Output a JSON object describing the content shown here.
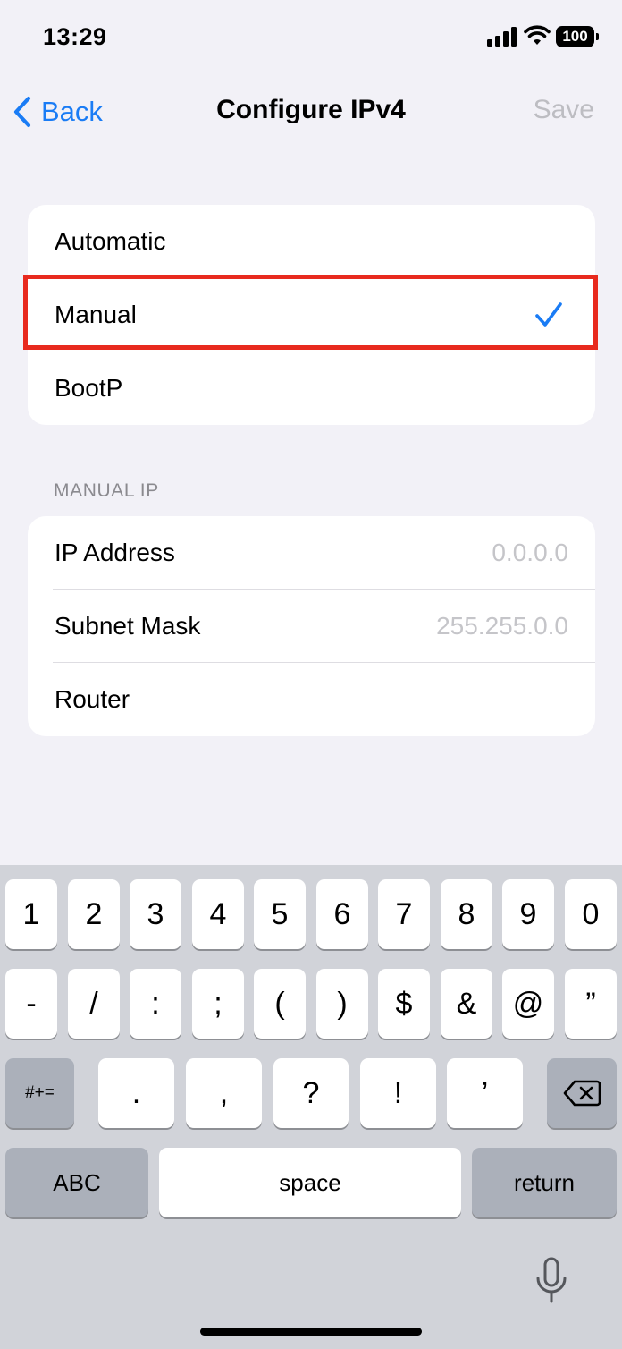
{
  "status_bar": {
    "time": "13:29",
    "battery": "100"
  },
  "nav": {
    "back_label": "Back",
    "title": "Configure IPv4",
    "save_label": "Save"
  },
  "modes": [
    {
      "label": "Automatic",
      "selected": false
    },
    {
      "label": "Manual",
      "selected": true
    },
    {
      "label": "BootP",
      "selected": false
    }
  ],
  "manual_ip": {
    "header": "MANUAL IP",
    "fields": [
      {
        "label": "IP Address",
        "placeholder": "0.0.0.0"
      },
      {
        "label": "Subnet Mask",
        "placeholder": "255.255.0.0"
      },
      {
        "label": "Router",
        "placeholder": ""
      }
    ]
  },
  "keyboard": {
    "row1": [
      "1",
      "2",
      "3",
      "4",
      "5",
      "6",
      "7",
      "8",
      "9",
      "0"
    ],
    "row2": [
      "-",
      "/",
      ":",
      ";",
      "(",
      ")",
      "$",
      "&",
      "@",
      "”"
    ],
    "row3": [
      ".",
      ",",
      "?",
      "!",
      "’"
    ],
    "shift_label": "#+=",
    "abc_label": "ABC",
    "space_label": "space",
    "return_label": "return"
  },
  "icons": {
    "back": "chevron-left-icon",
    "check": "checkmark-icon",
    "delete": "delete-backspace-icon",
    "mic": "microphone-icon"
  },
  "colors": {
    "accent": "#1a7cf5",
    "highlight": "#e82a1e",
    "background": "#f2f1f7"
  }
}
